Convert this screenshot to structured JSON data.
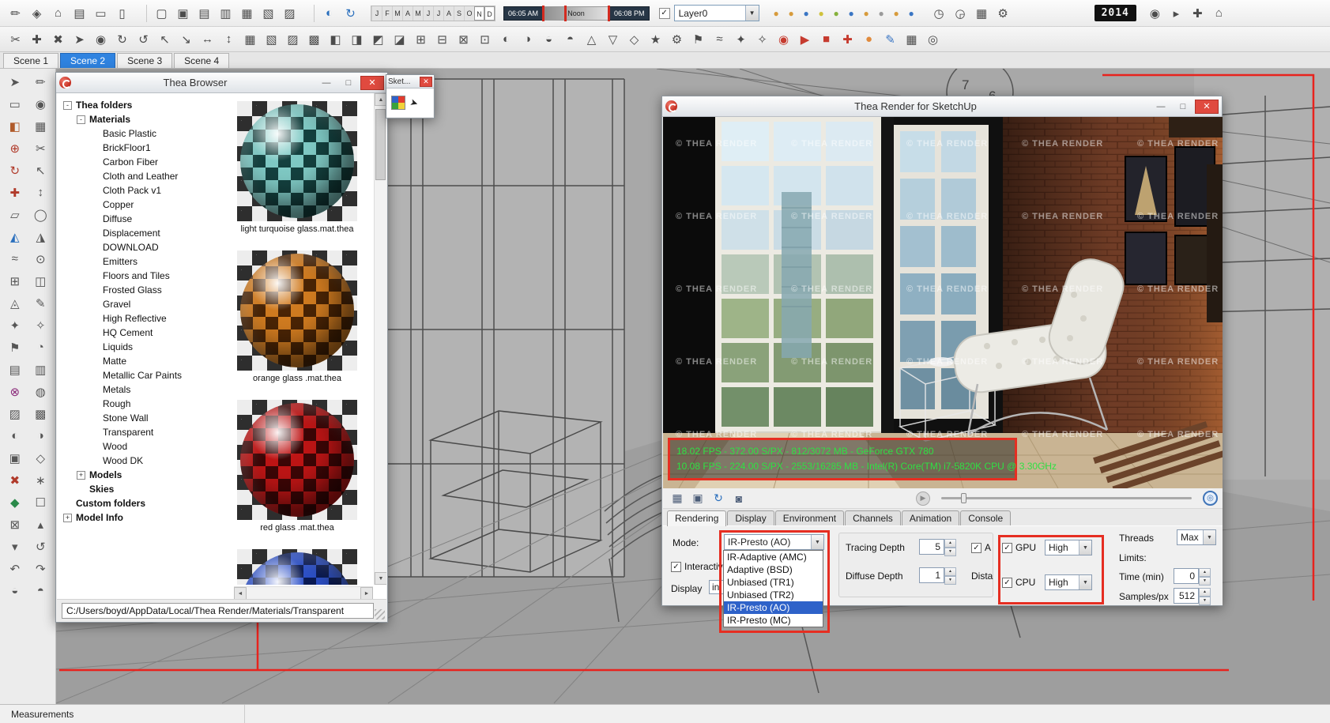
{
  "chrome": {
    "minimize": "—",
    "maximize": "□",
    "close": "✕"
  },
  "icons": {
    "check": "✓",
    "combo_arrow": "▼",
    "spin_up": "▲",
    "spin_down": "▼",
    "scroll_up": "▲",
    "scroll_down": "▼",
    "scroll_left": "◄",
    "scroll_right": "►",
    "save": "▦",
    "save_all": "▣",
    "refresh": "↻",
    "camera": "◙",
    "play": "▶",
    "target": "◎",
    "cursor": "➤",
    "layer_arrow": "▼",
    "detail": "▸"
  },
  "toolbars": {
    "row1_left": [
      {
        "name": "pencil-icon",
        "g": "✏"
      },
      {
        "name": "component-icon",
        "g": "◈"
      },
      {
        "name": "house-icon",
        "g": "⌂"
      },
      {
        "name": "printer-icon",
        "g": "▤"
      },
      {
        "name": "folder-icon",
        "g": "▭"
      },
      {
        "name": "page-icon",
        "g": "▯"
      }
    ],
    "row1_styles": [
      {
        "name": "style-xray-icon",
        "g": "▢"
      },
      {
        "name": "style-back-edges-icon",
        "g": "▣"
      },
      {
        "name": "style-wireframe-icon",
        "g": "▤"
      },
      {
        "name": "style-hidden-line-icon",
        "g": "▥"
      },
      {
        "name": "style-shaded-icon",
        "g": "▦"
      },
      {
        "name": "style-textured-icon",
        "g": "▧"
      },
      {
        "name": "style-monochrome-icon",
        "g": "▨"
      }
    ],
    "row1_nav": [
      {
        "name": "orbit-icon",
        "g": "◐",
        "c": "#2a6fbd"
      },
      {
        "name": "zoom-extents-icon",
        "g": "↻",
        "c": "#2a6fbd"
      }
    ],
    "months": [
      "J",
      "F",
      "M",
      "A",
      "M",
      "J",
      "J",
      "A",
      "S",
      "O",
      "N",
      "D"
    ],
    "time_start": "06:05 AM",
    "time_mid": "Noon",
    "time_end": "06:08 PM",
    "layer_select": "Layer0",
    "row1_act": [
      {
        "name": "act-camera-icon",
        "g": "●",
        "c": "#d79b3c"
      },
      {
        "name": "act-camera-icon",
        "g": "●",
        "c": "#d79b3c"
      },
      {
        "name": "act-camera-icon",
        "g": "●",
        "c": "#3a76c4"
      },
      {
        "name": "act-camera-icon",
        "g": "●",
        "c": "#d0c23c"
      },
      {
        "name": "act-camera-icon",
        "g": "●",
        "c": "#86b13c"
      },
      {
        "name": "act-camera-icon",
        "g": "●",
        "c": "#3a76c4"
      },
      {
        "name": "act-camera-icon",
        "g": "●",
        "c": "#d79b3c"
      },
      {
        "name": "act-camera-icon",
        "g": "●",
        "c": "#9a9a9a"
      },
      {
        "name": "act-camera-icon",
        "g": "●",
        "c": "#d79b3c"
      },
      {
        "name": "act-camera-icon",
        "g": "●",
        "c": "#3a76c4"
      }
    ],
    "row1_mid": [
      {
        "name": "clock-icon",
        "g": "◷"
      },
      {
        "name": "shadow-icon",
        "g": "◶"
      },
      {
        "name": "grid-icon",
        "g": "▦"
      },
      {
        "name": "settings-icon",
        "g": "⚙"
      }
    ],
    "year": "2014",
    "row1_right": [
      {
        "name": "walk-icon",
        "g": "◉"
      },
      {
        "name": "section-icon",
        "g": "▸"
      },
      {
        "name": "add-location-icon",
        "g": "✚"
      },
      {
        "name": "model-info-icon",
        "g": "⌂"
      }
    ],
    "row2": [
      {
        "name": "plugin-icon",
        "g": "✂"
      },
      {
        "name": "plugin-icon",
        "g": "✚"
      },
      {
        "name": "plugin-icon",
        "g": "✖"
      },
      {
        "name": "plugin-icon",
        "g": "➤"
      },
      {
        "name": "plugin-icon",
        "g": "◉"
      },
      {
        "name": "plugin-icon",
        "g": "↻"
      },
      {
        "name": "plugin-icon",
        "g": "↺"
      },
      {
        "name": "plugin-icon",
        "g": "↖"
      },
      {
        "name": "plugin-icon",
        "g": "↘"
      },
      {
        "name": "plugin-icon",
        "g": "↔"
      },
      {
        "name": "plugin-icon",
        "g": "↕"
      },
      {
        "name": "plugin-icon",
        "g": "▦"
      },
      {
        "name": "plugin-icon",
        "g": "▧"
      },
      {
        "name": "plugin-icon",
        "g": "▨"
      },
      {
        "name": "plugin-icon",
        "g": "▩"
      },
      {
        "name": "plugin-icon",
        "g": "◧"
      },
      {
        "name": "plugin-icon",
        "g": "◨"
      },
      {
        "name": "plugin-icon",
        "g": "◩"
      },
      {
        "name": "plugin-icon",
        "g": "◪"
      },
      {
        "name": "plugin-icon",
        "g": "⊞"
      },
      {
        "name": "plugin-icon",
        "g": "⊟"
      },
      {
        "name": "plugin-icon",
        "g": "⊠"
      },
      {
        "name": "plugin-icon",
        "g": "⊡"
      },
      {
        "name": "plugin-icon",
        "g": "◐"
      },
      {
        "name": "plugin-icon",
        "g": "◑"
      },
      {
        "name": "plugin-icon",
        "g": "◒"
      },
      {
        "name": "plugin-icon",
        "g": "◓"
      },
      {
        "name": "plugin-icon",
        "g": "△"
      },
      {
        "name": "plugin-icon",
        "g": "▽"
      },
      {
        "name": "plugin-icon",
        "g": "◇"
      },
      {
        "name": "plugin-icon",
        "g": "★"
      },
      {
        "name": "plugin-icon",
        "g": "⚙"
      },
      {
        "name": "plugin-icon",
        "g": "⚑"
      },
      {
        "name": "plugin-icon",
        "g": "≈"
      },
      {
        "name": "plugin-icon",
        "g": "✦"
      },
      {
        "name": "plugin-icon",
        "g": "✧"
      },
      {
        "name": "thea-render-icon",
        "g": "◉",
        "c": "#c63b2f"
      },
      {
        "name": "thea-ir-icon",
        "g": "▶",
        "c": "#c63b2f"
      },
      {
        "name": "thea-stop-icon",
        "g": "■",
        "c": "#c63b2f"
      },
      {
        "name": "thea-material-icon",
        "g": "✚",
        "c": "#c63b2f"
      },
      {
        "name": "thea-browser-icon",
        "g": "●",
        "c": "#e08a3c"
      },
      {
        "name": "measure-icon",
        "g": "✎",
        "c": "#3a76c4"
      },
      {
        "name": "grid-icon",
        "g": "▦"
      },
      {
        "name": "target-icon",
        "g": "◎"
      }
    ]
  },
  "scene_tabs": [
    {
      "label": "Scene 1"
    },
    {
      "label": "Scene 2",
      "active": true
    },
    {
      "label": "Scene 3"
    },
    {
      "label": "Scene 4"
    }
  ],
  "palette": [
    {
      "name": "select-tool-icon",
      "g": "➤"
    },
    {
      "name": "line-tool-icon",
      "g": "✏"
    },
    {
      "name": "eraser-tool-icon",
      "g": "▭"
    },
    {
      "name": "circle-tool-icon",
      "g": "◉"
    },
    {
      "name": "paint-tool-icon",
      "g": "◧",
      "c": "#b05a2a"
    },
    {
      "name": "rectangle-tool-icon",
      "g": "▦"
    },
    {
      "name": "move-tool-icon",
      "g": "⊕",
      "c": "#b03a2a"
    },
    {
      "name": "scissors-tool-icon",
      "g": "✂"
    },
    {
      "name": "rotate-tool-icon",
      "g": "↻",
      "c": "#b03a2a"
    },
    {
      "name": "scale-tool-icon",
      "g": "↖"
    },
    {
      "name": "pushpull-tool-icon",
      "g": "✚",
      "c": "#b03a2a"
    },
    {
      "name": "offset-tool-icon",
      "g": "↕"
    },
    {
      "name": "polygon-tool-icon",
      "g": "▱"
    },
    {
      "name": "arc-tool-icon",
      "g": "◯"
    },
    {
      "name": "axes-tool-icon",
      "g": "◭",
      "c": "#2a6fbd"
    },
    {
      "name": "dim-tool-icon",
      "g": "◮"
    },
    {
      "name": "freehand-tool-icon",
      "g": "≈"
    },
    {
      "name": "tape-tool-icon",
      "g": "⊙"
    },
    {
      "name": "protractor-tool-icon",
      "g": "⊞"
    },
    {
      "name": "text-tool-icon",
      "g": "◫"
    },
    {
      "name": "section-tool-icon",
      "g": "◬"
    },
    {
      "name": "label-tool-icon",
      "g": "✎"
    },
    {
      "name": "zoom-tool-icon",
      "g": "✦"
    },
    {
      "name": "pan-tool-icon",
      "g": "✧"
    },
    {
      "name": "walk-tool-icon",
      "g": "⚑"
    },
    {
      "name": "orbit-tool-icon",
      "g": "◔"
    },
    {
      "name": "layer-tool-icon",
      "g": "▤"
    },
    {
      "name": "style-tool-icon",
      "g": "▥"
    },
    {
      "name": "solid-tool-icon",
      "g": "⊗",
      "c": "#8a2a7a"
    },
    {
      "name": "follow-tool-icon",
      "g": "◍"
    },
    {
      "name": "shadow-tool-icon",
      "g": "▨"
    },
    {
      "name": "fog-tool-icon",
      "g": "▩"
    },
    {
      "name": "match-tool-icon",
      "g": "◐"
    },
    {
      "name": "soften-tool-icon",
      "g": "◑"
    },
    {
      "name": "outliner-tool-icon",
      "g": "▣"
    },
    {
      "name": "component-tool-icon",
      "g": "◇"
    },
    {
      "name": "delete-tool-icon",
      "g": "✖",
      "c": "#b03a2a"
    },
    {
      "name": "snap-tool-icon",
      "g": "∗"
    },
    {
      "name": "material-tool-icon",
      "g": "◆",
      "c": "#2a8a4a"
    },
    {
      "name": "box-tool-icon",
      "g": "☐"
    },
    {
      "name": "group-tool-icon",
      "g": "⊠"
    },
    {
      "name": "up-tool-icon",
      "g": "▴"
    },
    {
      "name": "down-tool-icon",
      "g": "▾"
    },
    {
      "name": "undo-tool-icon",
      "g": "↺"
    },
    {
      "name": "redo-tool-icon",
      "g": "↶"
    },
    {
      "name": "repeat-tool-icon",
      "g": "↷"
    },
    {
      "name": "half-tool-icon",
      "g": "◒"
    },
    {
      "name": "sphere-tool-icon",
      "g": "◓"
    }
  ],
  "thea_browser": {
    "title": "Thea Browser",
    "tree": [
      {
        "label": "Thea folders",
        "level": 0,
        "expander": "-",
        "bold": true
      },
      {
        "label": "Materials",
        "level": 1,
        "expander": "-",
        "bold": true
      },
      {
        "label": "Basic Plastic",
        "level": 2
      },
      {
        "label": "BrickFloor1",
        "level": 2
      },
      {
        "label": "Carbon Fiber",
        "level": 2
      },
      {
        "label": "Cloth and Leather",
        "level": 2
      },
      {
        "label": "Cloth Pack v1",
        "level": 2
      },
      {
        "label": "Copper",
        "level": 2
      },
      {
        "label": "Diffuse",
        "level": 2
      },
      {
        "label": "Displacement",
        "level": 2
      },
      {
        "label": "DOWNLOAD",
        "level": 2
      },
      {
        "label": "Emitters",
        "level": 2
      },
      {
        "label": "Floors and Tiles",
        "level": 2
      },
      {
        "label": "Frosted Glass",
        "level": 2
      },
      {
        "label": "Gravel",
        "level": 2
      },
      {
        "label": "High Reflective",
        "level": 2
      },
      {
        "label": "HQ Cement",
        "level": 2
      },
      {
        "label": "Liquids",
        "level": 2
      },
      {
        "label": "Matte",
        "level": 2
      },
      {
        "label": "Metallic Car Paints",
        "level": 2
      },
      {
        "label": "Metals",
        "level": 2
      },
      {
        "label": "Rough",
        "level": 2
      },
      {
        "label": "Stone Wall",
        "level": 2
      },
      {
        "label": "Transparent",
        "level": 2
      },
      {
        "label": "Wood",
        "level": 2
      },
      {
        "label": "Wood DK",
        "level": 2
      },
      {
        "label": "Models",
        "level": 1,
        "expander": "+",
        "bold": true
      },
      {
        "label": "Skies",
        "level": 1,
        "bold": true
      },
      {
        "label": "Custom folders",
        "level": 0,
        "bold": true
      },
      {
        "label": "Model Info",
        "level": 0,
        "expander": "+",
        "bold": true
      }
    ],
    "materials": [
      {
        "label": "light turquoise glass.mat.thea",
        "cd": "#14413f",
        "cl": "#7fc9c4"
      },
      {
        "label": "orange glass .mat.thea",
        "cd": "#4a2405",
        "cl": "#d07b20"
      },
      {
        "label": "red glass .mat.thea",
        "cd": "#3c0606",
        "cl": "#bd1515"
      },
      {
        "label": "",
        "cd": "#0a1a54",
        "cl": "#2c50c8"
      }
    ],
    "path": "C:/Users/boyd/AppData/Local/Thea Render/Materials/Transparent"
  },
  "sket_window": {
    "title": "Sket..."
  },
  "render_window": {
    "title": "Thea Render for SketchUp",
    "watermark": "THEA RENDER",
    "stats_gpu": "18.02 FPS - 372.00 S/PX - 812/3072 MB - GeForce GTX 780",
    "stats_cpu": "10.08 FPS - 224.00 S/PX - 2553/16285 MB - Intel(R) Core(TM) i7-5820K CPU @ 3.30GHz",
    "tabs": [
      {
        "label": "Rendering",
        "active": true
      },
      {
        "label": "Display"
      },
      {
        "label": "Environment"
      },
      {
        "label": "Channels"
      },
      {
        "label": "Animation"
      },
      {
        "label": "Console"
      }
    ],
    "mode_label": "Mode:",
    "mode_value": "IR-Presto (AO)",
    "mode_options": [
      {
        "label": "IR-Adaptive (AMC)"
      },
      {
        "label": "Adaptive (BSD)"
      },
      {
        "label": "Unbiased (TR1)"
      },
      {
        "label": "Unbiased (TR2)"
      },
      {
        "label": "IR-Presto (AO)",
        "selected": true
      },
      {
        "label": "IR-Presto (MC)"
      }
    ],
    "interactive_label": "Interactiv",
    "display_label": "Display",
    "display_value": "in",
    "tracing_depth_label": "Tracing Depth",
    "tracing_depth_value": "5",
    "diffuse_depth_label": "Diffuse Depth",
    "diffuse_depth_value": "1",
    "supersampling_label": "A",
    "distance_label": "Dista",
    "gpu_label": "GPU",
    "gpu_value": "High",
    "cpu_label": "CPU",
    "cpu_value": "High",
    "threads_label": "Threads",
    "threads_value": "Max",
    "limits_label": "Limits:",
    "time_label": "Time (min)",
    "time_value": "0",
    "samples_label": "Samples/px",
    "samples_value": "512"
  },
  "statusbar": {
    "measurements_label": "Measurements"
  }
}
